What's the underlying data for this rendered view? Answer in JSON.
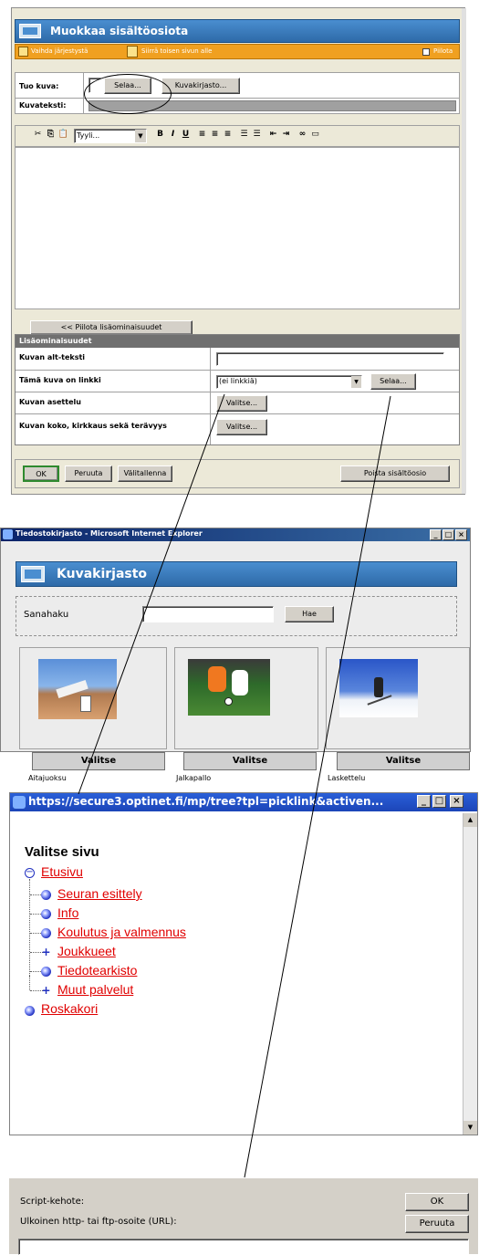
{
  "editor": {
    "title": "Muokkaa sisältöosiota",
    "order_label": "Vaihda järjestystä",
    "move_label": "Siirrä toisen sivun alle",
    "hide_label": "Piilota",
    "import_label": "Tuo kuva:",
    "browse_label": "Selaa...",
    "library_label": "Kuvakirjasto...",
    "caption_label": "Kuvateksti:",
    "style_select": "Tyyli...",
    "toolbar_bold": "B",
    "toolbar_italic": "I",
    "toolbar_underline": "U",
    "hide_extra_label": "<< Piilota lisäominaisuudet",
    "extras_header": "Lisäominaisuudet",
    "alt_label": "Kuvan alt-teksti",
    "link_label": "Tämä kuva on linkki",
    "link_select": "(ei linkkiä)",
    "link_browse": "Selaa...",
    "layout_label": "Kuvan asettelu",
    "layout_button": "Valitse...",
    "size_label": "Kuvan koko, kirkkaus sekä terävyys",
    "size_button": "Valitse...",
    "ok": "OK",
    "cancel": "Peruuta",
    "save_draft": "Välitallenna",
    "delete": "Poista sisältöosio"
  },
  "library_window": {
    "title": "Tiedostokirjasto - Microsoft Internet Explorer",
    "header": "Kuvakirjasto",
    "search_label": "Sanahaku",
    "search_value": "",
    "search_button": "Hae",
    "items": [
      {
        "button": "Valitse",
        "caption": "Aitajuoksu"
      },
      {
        "button": "Valitse",
        "caption": "Jalkapallo"
      },
      {
        "button": "Valitse",
        "caption": "Laskettelu"
      }
    ]
  },
  "page_picker": {
    "url": "https://secure3.optinet.fi/mp/tree?tpl=picklink&activen...",
    "heading": "Valitse sivu",
    "root": "Etusivu",
    "children": [
      "Seuran esittely",
      "Info",
      "Koulutus ja valmennus",
      "Joukkueet",
      "Tiedotearkisto",
      "Muut palvelut"
    ],
    "trash": "Roskakori"
  },
  "script_prompt": {
    "title": "Script-kehote:",
    "label": "Ulkoinen http- tai ftp-osoite (URL):",
    "value": "",
    "ok": "OK",
    "cancel": "Peruuta"
  },
  "colors": {
    "header_blue": "#3a7cc0",
    "orange_bar": "#f0a020",
    "link_red": "#e00000",
    "xp_title": "#1c5fd6"
  }
}
